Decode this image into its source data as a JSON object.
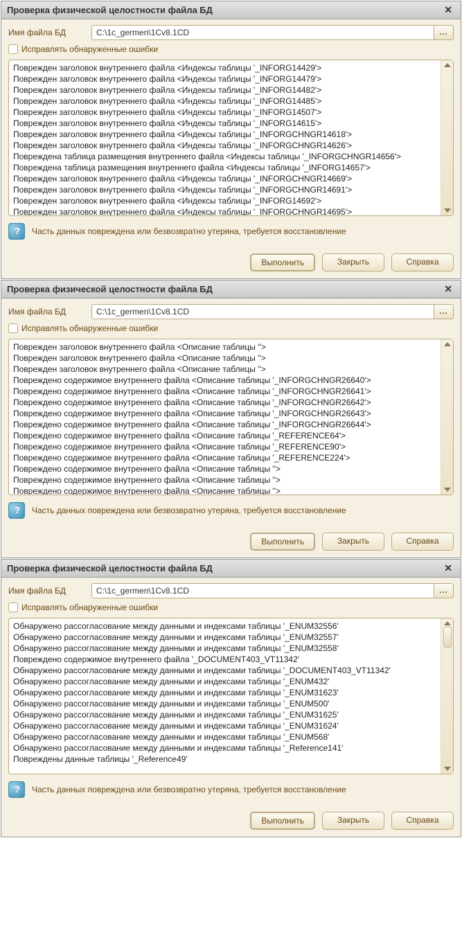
{
  "common": {
    "title": "Проверка физической целостности файла БД",
    "filename_label": "Имя файла БД",
    "path": "C:\\1c_germen\\1Cv8.1CD",
    "browse_label": "...",
    "fix_checkbox_label": "Исправлять обнаруженные ошибки",
    "status_text": "Часть данных повреждена или безвозвратно утеряна, требуется восстановление",
    "btn_run": "Выполнить",
    "btn_close": "Закрыть",
    "btn_help": "Справка"
  },
  "dialog1": {
    "log_lines": [
      "Поврежден заголовок внутреннего файла <Индексы таблицы '_INFORG14429'>",
      "Поврежден заголовок внутреннего файла <Индексы таблицы '_INFORG14479'>",
      "Поврежден заголовок внутреннего файла <Индексы таблицы '_INFORG14482'>",
      "Поврежден заголовок внутреннего файла <Индексы таблицы '_INFORG14485'>",
      "Поврежден заголовок внутреннего файла <Индексы таблицы '_INFORG14507'>",
      "Поврежден заголовок внутреннего файла <Индексы таблицы '_INFORG14615'>",
      "Поврежден заголовок внутреннего файла <Индексы таблицы '_INFORGCHNGR14618'>",
      "Поврежден заголовок внутреннего файла <Индексы таблицы '_INFORGCHNGR14626'>",
      "Повреждена таблица размещения внутреннего файла <Индексы таблицы '_INFORGCHNGR14656'>",
      "Повреждена таблица размещения внутреннего файла <Индексы таблицы '_INFORG14657'>",
      "Поврежден заголовок внутреннего файла <Индексы таблицы '_INFORGCHNGR14669'>",
      "Поврежден заголовок внутреннего файла <Индексы таблицы '_INFORGCHNGR14691'>",
      "Поврежден заголовок внутреннего файла <Индексы таблицы '_INFORG14692'>",
      "Поврежден заголовок внутреннего файла <Индексы таблицы '_INFORGCHNGR14695'>"
    ]
  },
  "dialog2": {
    "log_lines": [
      "Поврежден заголовок внутреннего файла <Описание таблицы ''>",
      "Поврежден заголовок внутреннего файла <Описание таблицы ''>",
      "Поврежден заголовок внутреннего файла <Описание таблицы ''>",
      "Повреждено содержимое внутреннего файла <Описание таблицы '_INFORGCHNGR26640'>",
      "Повреждено содержимое внутреннего файла <Описание таблицы '_INFORGCHNGR26641'>",
      "Повреждено содержимое внутреннего файла <Описание таблицы '_INFORGCHNGR26642'>",
      "Повреждено содержимое внутреннего файла <Описание таблицы '_INFORGCHNGR26643'>",
      "Повреждено содержимое внутреннего файла <Описание таблицы '_INFORGCHNGR26644'>",
      "Повреждено содержимое внутреннего файла <Описание таблицы '_REFERENCE64'>",
      "Повреждено содержимое внутреннего файла <Описание таблицы '_REFERENCE90'>",
      "Повреждено содержимое внутреннего файла <Описание таблицы '_REFERENCE224'>",
      "Повреждено содержимое внутреннего файла <Описание таблицы ''>",
      "Повреждено содержимое внутреннего файла <Описание таблицы ''>",
      "Повреждено содержимое внутреннего файла <Описание таблицы ''>"
    ]
  },
  "dialog3": {
    "log_lines": [
      "Обнаружено рассогласование между данными и индексами таблицы '_ENUM32556'",
      "Обнаружено рассогласование между данными и индексами таблицы '_ENUM32557'",
      "Обнаружено рассогласование между данными и индексами таблицы '_ENUM32558'",
      "Повреждено содержимое внутреннего файла '_DOCUMENT403_VT11342'",
      "Обнаружено рассогласование между данными и индексами таблицы '_DOCUMENT403_VT11342'",
      "Обнаружено рассогласование между данными и индексами таблицы '_ENUM432'",
      "Обнаружено рассогласование между данными и индексами таблицы '_ENUM31623'",
      "Обнаружено рассогласование между данными и индексами таблицы '_ENUM500'",
      "Обнаружено рассогласование между данными и индексами таблицы '_ENUM31625'",
      "Обнаружено рассогласование между данными и индексами таблицы '_ENUM31624'",
      "Обнаружено рассогласование между данными и индексами таблицы '_ENUM568'",
      "Обнаружено рассогласование между данными и индексами таблицы '_Reference141'",
      "Повреждены данные таблицы '_Reference49'"
    ]
  }
}
